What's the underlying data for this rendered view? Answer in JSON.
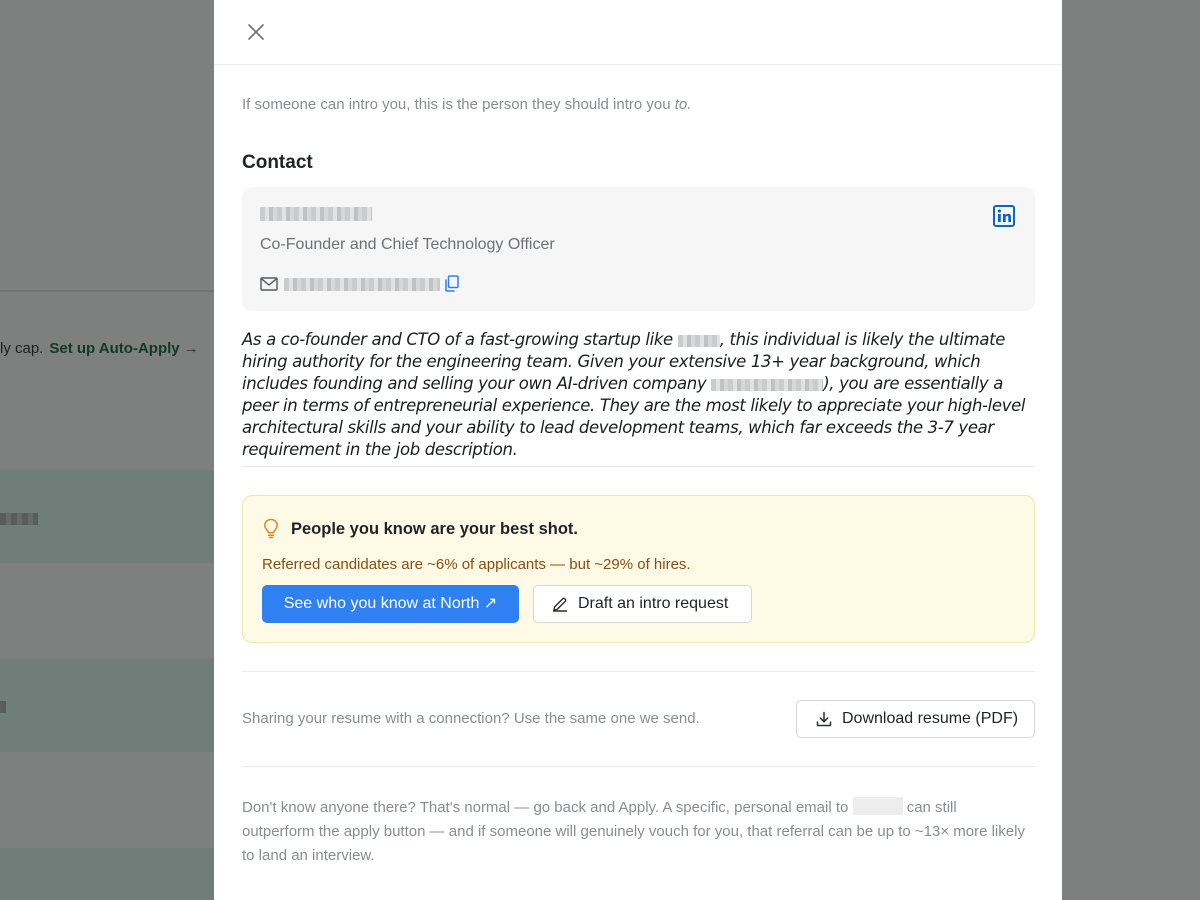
{
  "background": {
    "notice_text": "ly cap.",
    "auto_apply_link": "Set up Auto-Apply →"
  },
  "modal": {
    "close_icon": "close-icon",
    "intro_hint_prefix": "If someone can intro you, this is the person they should intro you ",
    "intro_hint_emphasis": "to.",
    "contact": {
      "section_title": "Contact",
      "role": "Co-Founder and Chief Technology Officer",
      "icons": [
        "mail-icon",
        "copy-icon",
        "linkedin-icon"
      ],
      "linkedin_color": "#0a66c2"
    },
    "bio": {
      "part1": "As a co-founder and CTO of a fast-growing startup like ",
      "part2": ", this individual is likely the ultimate hiring authority for the engineering team. Given your extensive 13+ year background, which includes founding and selling your own AI-driven company ",
      "part3": "), you are essentially a peer in terms of entrepreneurial experience. They are the most likely to appreciate your high-level architectural skills and your ability to lead development teams, which far exceeds the 3-7 year requirement in the job description."
    },
    "tip": {
      "title": "People you know are your best shot.",
      "stat": "Referred candidates are ~6% of applicants — but ~29% of hires.",
      "primary_button": "See who you know at North ↗",
      "secondary_button": "Draft an intro request",
      "accent_color": "#2f80f0",
      "background_color": "#fefae6"
    },
    "resume": {
      "share_text": "Sharing your resume with a connection? Use the same one we send.",
      "download_button": "Download resume (PDF)"
    },
    "footer": {
      "part1": "Don't know anyone there? That's normal — go back and Apply. A specific, personal email to ",
      "part2": " can still outperform the apply button — and if someone will genuinely vouch for you, that referral can be up to ~13× more likely to land an interview."
    }
  }
}
